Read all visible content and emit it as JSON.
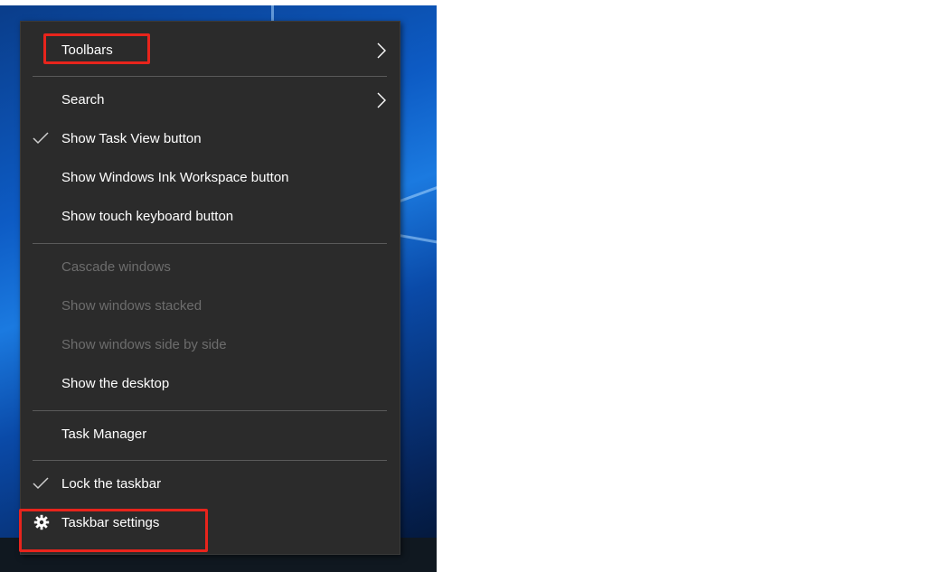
{
  "context_menu": {
    "items": [
      {
        "label": "Toolbars",
        "submenu": true,
        "enabled": true,
        "checked": false,
        "icon": "chevron-right-icon"
      },
      {
        "label": "Search",
        "submenu": true,
        "enabled": true,
        "checked": false,
        "icon": "chevron-right-icon"
      },
      {
        "label": "Show Task View button",
        "enabled": true,
        "checked": true,
        "icon": "checkmark-icon"
      },
      {
        "label": "Show Windows Ink Workspace button",
        "enabled": true,
        "checked": false
      },
      {
        "label": "Show touch keyboard button",
        "enabled": true,
        "checked": false
      },
      {
        "label": "Cascade windows",
        "enabled": false,
        "checked": false
      },
      {
        "label": "Show windows stacked",
        "enabled": false,
        "checked": false
      },
      {
        "label": "Show windows side by side",
        "enabled": false,
        "checked": false
      },
      {
        "label": "Show the desktop",
        "enabled": true,
        "checked": false
      },
      {
        "label": "Task Manager",
        "enabled": true,
        "checked": false
      },
      {
        "label": "Lock the taskbar",
        "enabled": true,
        "checked": true,
        "icon": "checkmark-icon"
      },
      {
        "label": "Taskbar settings",
        "enabled": true,
        "checked": false,
        "icon": "gear-icon"
      }
    ],
    "highlighted_items": [
      "Toolbars",
      "Taskbar settings"
    ]
  },
  "colors": {
    "menu_background": "#2b2b2b",
    "menu_text": "#ffffff",
    "disabled_text": "#6d6d6d",
    "separator": "#5a5a5a",
    "highlight_box": "#e8241c"
  }
}
